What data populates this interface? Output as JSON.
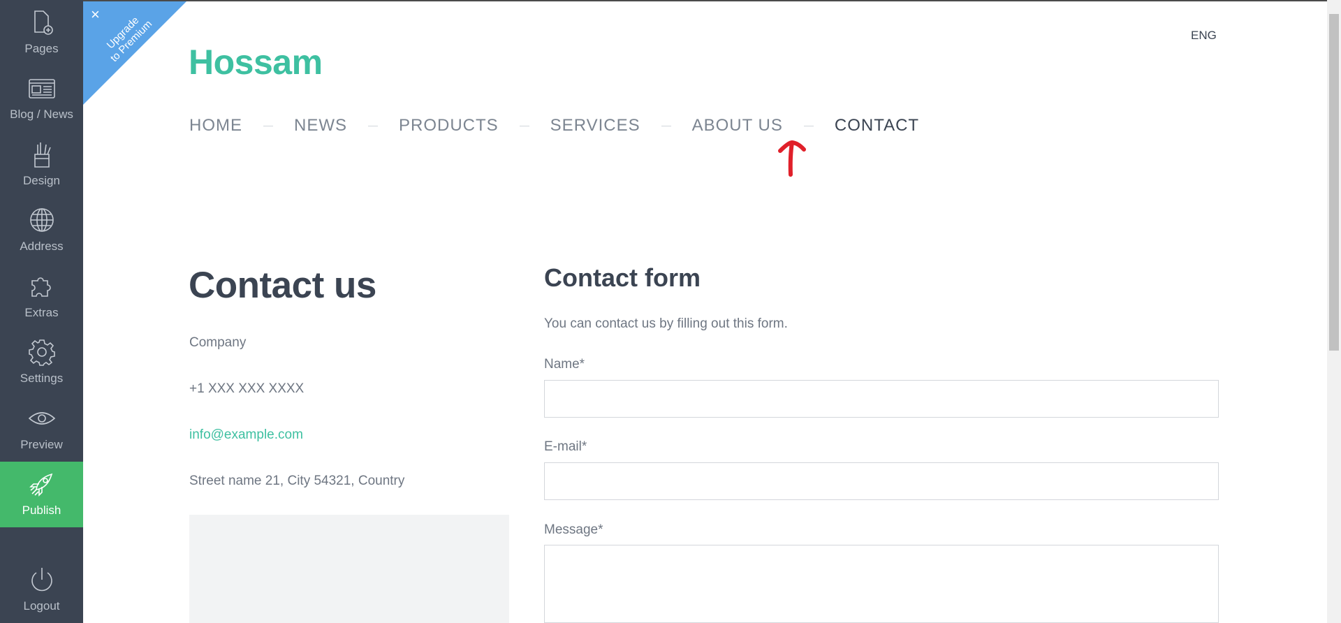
{
  "sidebar": {
    "items": [
      {
        "label": "Pages",
        "icon": "page-add-icon"
      },
      {
        "label": "Blog / News",
        "icon": "newspaper-icon"
      },
      {
        "label": "Design",
        "icon": "brush-cup-icon"
      },
      {
        "label": "Address",
        "icon": "globe-icon"
      },
      {
        "label": "Extras",
        "icon": "puzzle-icon"
      },
      {
        "label": "Settings",
        "icon": "gear-icon"
      },
      {
        "label": "Preview",
        "icon": "eye-icon"
      },
      {
        "label": "Publish",
        "icon": "rocket-icon"
      },
      {
        "label": "Logout",
        "icon": "power-icon"
      }
    ]
  },
  "ribbon": {
    "line1": "Upgrade",
    "line2": "to Premium",
    "close": "×"
  },
  "header": {
    "lang": "ENG",
    "brand": "Hossam",
    "nav": [
      "HOME",
      "NEWS",
      "PRODUCTS",
      "SERVICES",
      "ABOUT US",
      "CONTACT"
    ],
    "active_nav": "CONTACT"
  },
  "contact": {
    "title": "Contact us",
    "company": "Company",
    "phone": "+1 XXX XXX XXXX",
    "email": "info@example.com",
    "address": "Street name 21, City 54321, Country"
  },
  "form": {
    "title": "Contact form",
    "description": "You can contact us by filling out this form.",
    "name_label": "Name*",
    "email_label": "E-mail*",
    "message_label": "Message*",
    "name_value": "",
    "email_value": "",
    "message_value": ""
  },
  "colors": {
    "sidebar_bg": "#3b4452",
    "publish_bg": "#44b96b",
    "accent": "#3ec0a1",
    "ribbon": "#5aa3e7",
    "annotation": "#e0202a"
  }
}
